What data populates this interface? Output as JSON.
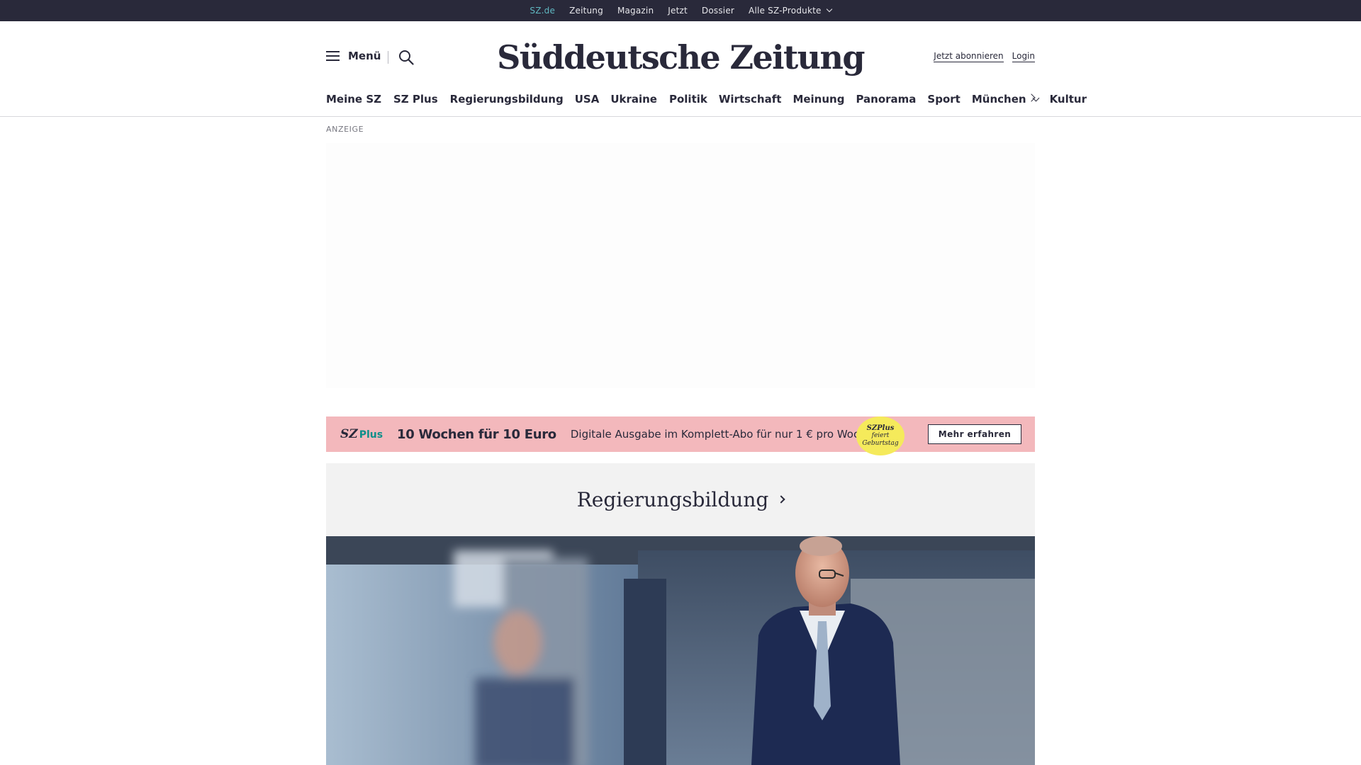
{
  "topbar": {
    "links": [
      "SZ.de",
      "Zeitung",
      "Magazin",
      "Jetzt",
      "Dossier",
      "Alle SZ-Produkte"
    ]
  },
  "header": {
    "menu_label": "Menü",
    "logo_text": "Süddeutsche Zeitung",
    "subscribe_label": "Jetzt abonnieren",
    "login_label": "Login"
  },
  "nav": {
    "items": [
      "Meine SZ",
      "SZ Plus",
      "Regierungsbildung",
      "USA",
      "Ukraine",
      "Politik",
      "Wirtschaft",
      "Meinung",
      "Panorama",
      "Sport",
      "München",
      "Kultur"
    ]
  },
  "ad": {
    "label": "ANZEIGE"
  },
  "promo": {
    "brand": "SZ",
    "brand_plus": "Plus",
    "title": "10 Wochen für 10 Euro",
    "text": "Digitale Ausgabe im Komplett-Abo für nur 1 € pro Woche.",
    "badge_line1": "SZPlus",
    "badge_line2": "feiert",
    "badge_line3": "Geburtstag",
    "button_label": "Mehr erfahren",
    "background_color": "#f3b8bc",
    "badge_color": "#f5ea5b"
  },
  "dossier": {
    "title": "Regierungsbildung"
  },
  "colors": {
    "topbar_bg": "#29293a",
    "active_link": "#5fb6c0",
    "text": "#29293a"
  }
}
